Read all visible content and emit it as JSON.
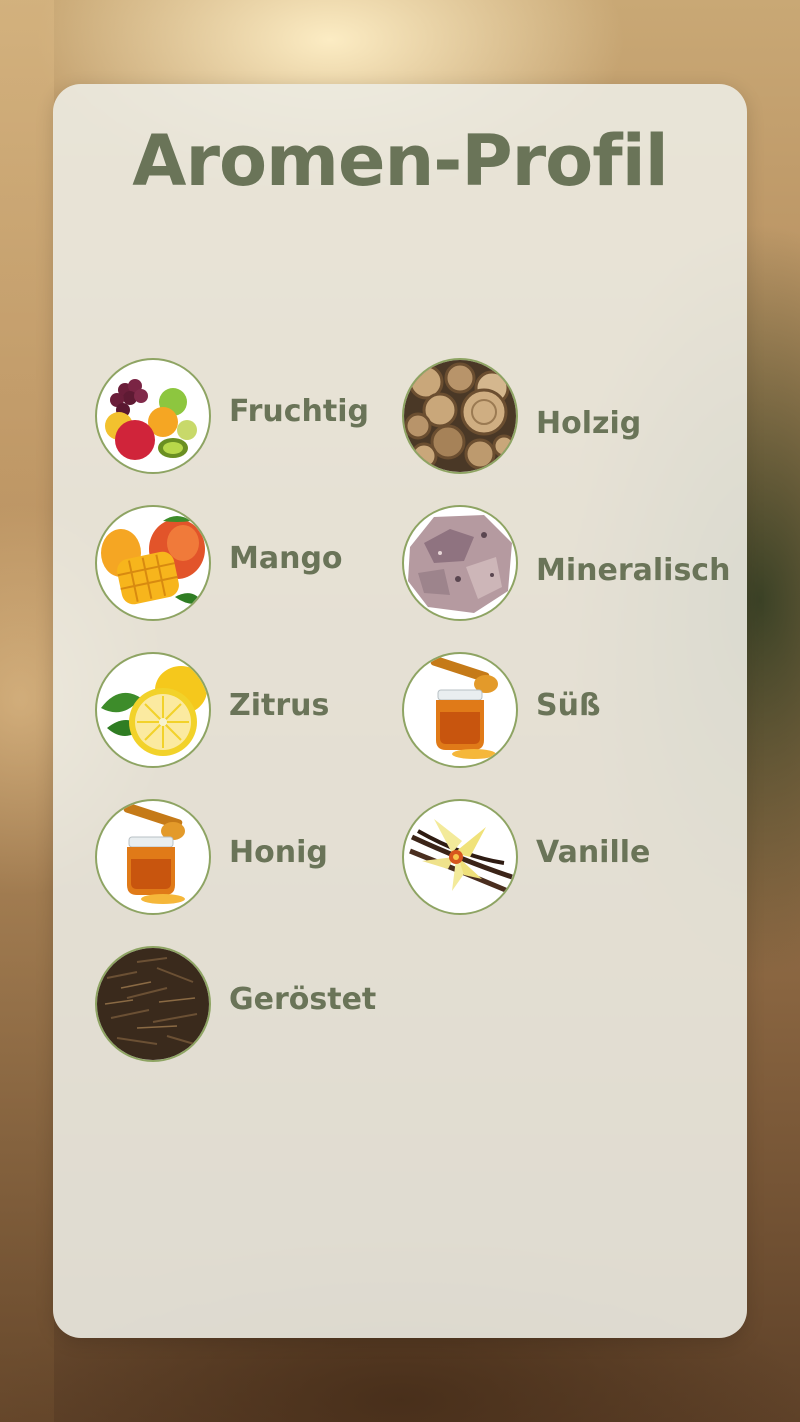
{
  "title": "Aromen-Profil",
  "accent_color": "#6a7458",
  "ring_color": "#8ea463",
  "aromas": [
    {
      "label": "Fruchtig",
      "icon": "fruits-icon"
    },
    {
      "label": "Holzig",
      "icon": "wood-logs-icon"
    },
    {
      "label": "Mango",
      "icon": "mango-icon"
    },
    {
      "label": "Mineralisch",
      "icon": "mineral-stone-icon"
    },
    {
      "label": "Zitrus",
      "icon": "lemon-icon"
    },
    {
      "label": "Süß",
      "icon": "honey-jar-icon"
    },
    {
      "label": "Honig",
      "icon": "honey-jar-icon"
    },
    {
      "label": "Vanille",
      "icon": "vanilla-flower-icon"
    },
    {
      "label": "Geröstet",
      "icon": "roasted-tea-icon"
    }
  ]
}
